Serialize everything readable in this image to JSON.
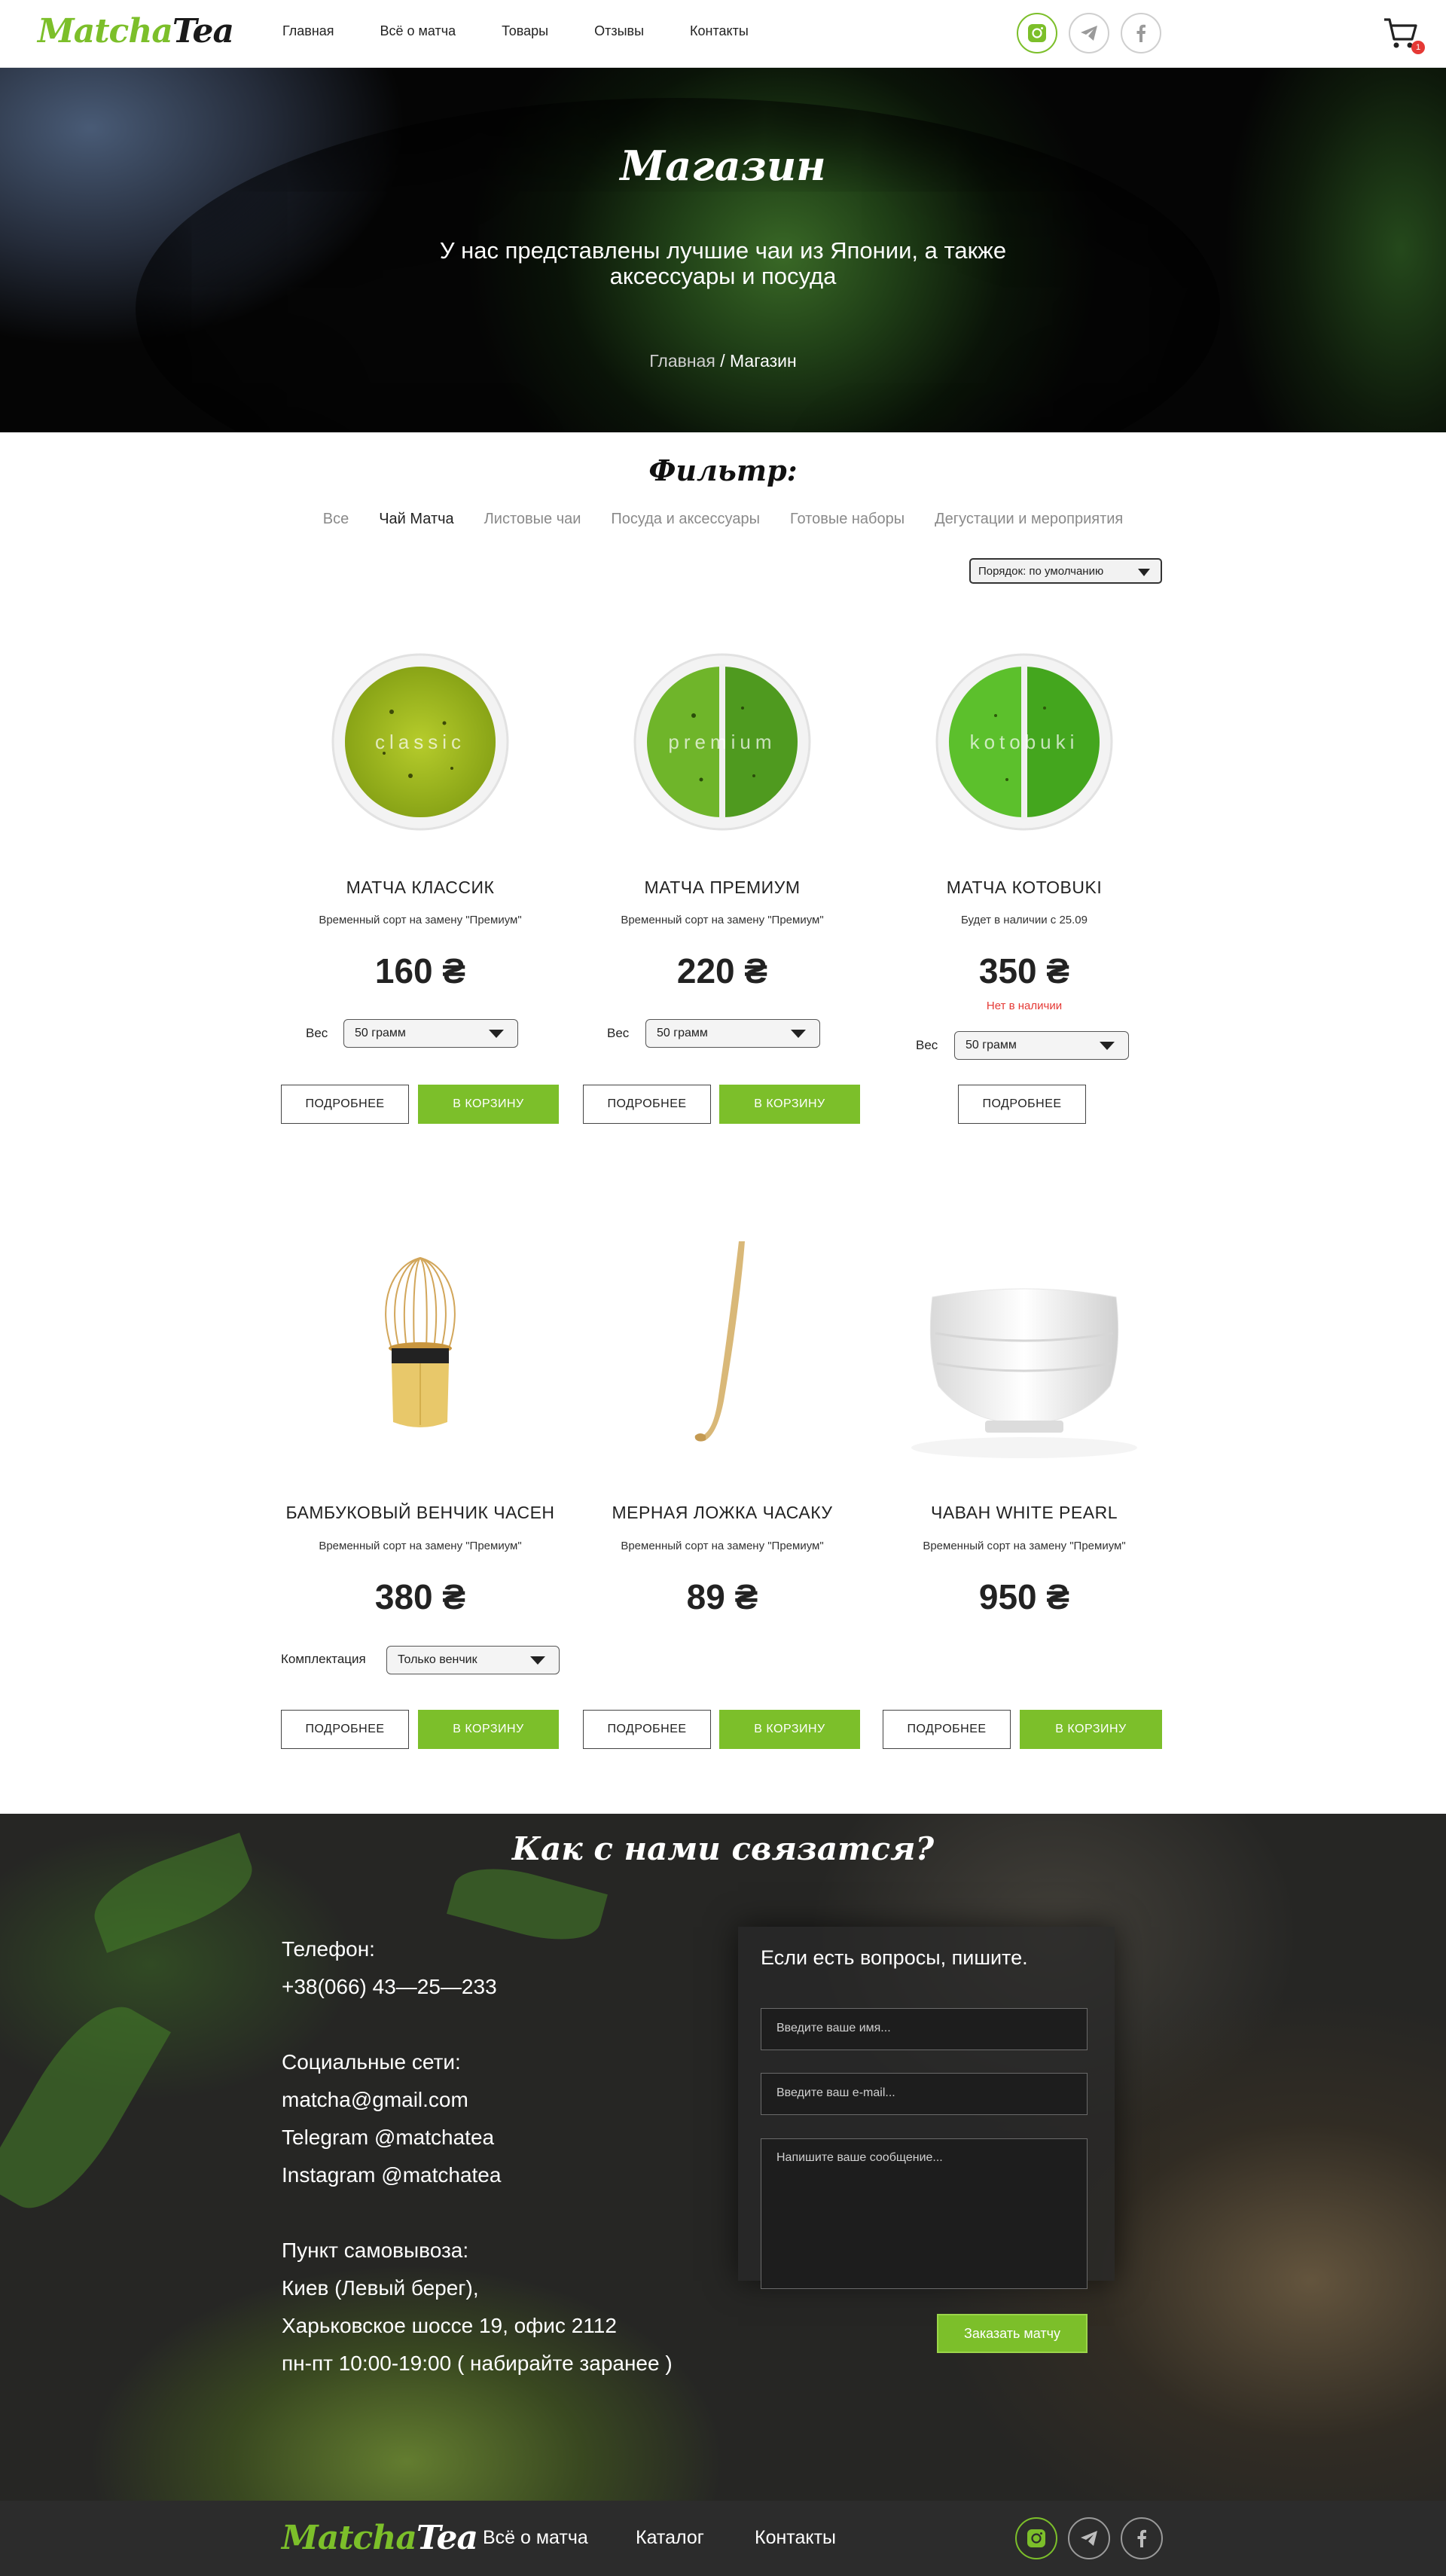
{
  "header": {
    "logo_part1": "Matcha",
    "logo_part2": "Tea",
    "nav": [
      "Главная",
      "Всё о матча",
      "Товары",
      "Отзывы",
      "Контакты"
    ],
    "cart_count": "1"
  },
  "hero": {
    "title": "Магазин",
    "subtitle_line1": "У нас представлены лучшие чаи из Японии, а также",
    "subtitle_line2": "аксессуары и посуда",
    "crumb_home": "Главная",
    "crumb_sep": " / ",
    "crumb_current": "Магазин"
  },
  "filter": {
    "title": "Фильтр:",
    "tabs": [
      "Все",
      "Чай Матча",
      "Листовые чаи",
      "Посуда и аксессуары",
      "Готовые наборы",
      "Дегустации и мероприятия"
    ],
    "active_tab": "Чай Матча",
    "sort_label": "Порядок: по умолчанию"
  },
  "products": [
    {
      "name": "МАТЧА КЛАССИК",
      "image_text": "classic",
      "desc": "Временный сорт на замену \"Премиум\"",
      "price": "160 ₴",
      "option_label": "Вес",
      "option_value": "50 грамм",
      "more": "ПОДРОБНЕЕ",
      "cart": "В КОРЗИНУ"
    },
    {
      "name": "МАТЧА ПРЕМИУМ",
      "image_text": "premium",
      "desc": "Временный сорт на замену \"Премиум\"",
      "price": "220 ₴",
      "option_label": "Вес",
      "option_value": "50 грамм",
      "more": "ПОДРОБНЕЕ",
      "cart": "В КОРЗИНУ"
    },
    {
      "name": "МАТЧА КОТОBUKI",
      "image_text": "kotobuki",
      "desc": "Будет в наличии с 25.09",
      "price": "350 ₴",
      "stock": "Нет в наличии",
      "option_label": "Вес",
      "option_value": "50 грамм",
      "more": "ПОДРОБНЕЕ"
    },
    {
      "name": "БАМБУКОВЫЙ ВЕНЧИК ЧАСЕН",
      "desc": "Временный сорт на замену \"Премиум\"",
      "price": "380 ₴",
      "option_label": "Комплектация",
      "option_value": "Только венчик",
      "more": "ПОДРОБНЕЕ",
      "cart": "В КОРЗИНУ"
    },
    {
      "name": "МЕРНАЯ ЛОЖКА ЧАСАКУ",
      "desc": "Временный сорт на замену \"Премиум\"",
      "price": "89 ₴",
      "more": "ПОДРОБНЕЕ",
      "cart": "В КОРЗИНУ"
    },
    {
      "name": "ЧАВАН WHITE PEARL",
      "desc": "Временный сорт на замену \"Премиум\"",
      "price": "950 ₴",
      "more": "ПОДРОБНЕЕ",
      "cart": "В КОРЗИНУ"
    }
  ],
  "contact": {
    "title": "Как с нами связатся?",
    "phone_label": "Телефон:",
    "phone": "+38(066) 43—25—233",
    "social_label": "Социальные сети:",
    "email": "matcha@gmail.com",
    "telegram": "Telegram @matchatea",
    "instagram": "Instagram @matchatea",
    "pickup_label": "Пункт самовывоза:",
    "pickup_city": "Киев (Левый берег),",
    "pickup_address": "Харьковское шоссе 19, офис 2112",
    "pickup_hours": "пн-пт 10:00-19:00 ( набирайте заранее )",
    "form_title": "Если есть вопросы, пишите.",
    "name_placeholder": "Введите ваше имя...",
    "email_placeholder": "Введите ваш e-mail...",
    "message_placeholder": "Напишите ваше сообщение...",
    "submit": "Заказать матчу"
  },
  "footer": {
    "logo_part1": "Matcha",
    "logo_part2": "Tea",
    "nav": [
      "Всё о матча",
      "Каталог",
      "Контакты"
    ]
  },
  "colors": {
    "accent": "#7cbf2a",
    "badge": "#e53935",
    "footer_bg": "#2c2c2c"
  },
  "icons": [
    "instagram-icon",
    "telegram-icon",
    "facebook-icon",
    "cart-icon"
  ]
}
